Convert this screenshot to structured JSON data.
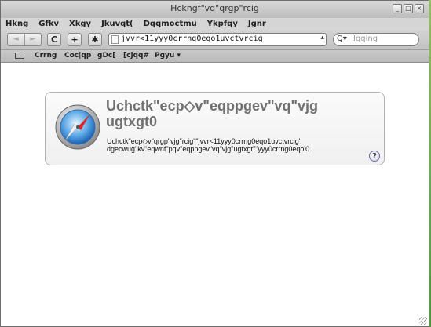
{
  "window": {
    "title": "Hckngf\"vq\"qrgp\"rcig"
  },
  "menubar": {
    "items": [
      "Hkng",
      "Gfkv",
      "Xkgy",
      "Jkuvqt(",
      "Dqqmoctmu",
      "Ykpfqy",
      "Jgnr"
    ]
  },
  "toolbar": {
    "back_label": "◄",
    "forward_label": "►",
    "reload_label": "C",
    "add_label": "+",
    "bug_label": "✱",
    "url": "jvvr<11yyy0crrng0eqo1uvctvrcig",
    "url_dropdown": "▴",
    "search_placeholder": "Iqqing",
    "search_icon": "Q▾"
  },
  "bookmarks": {
    "items": [
      "Crrng",
      "Coc|qp",
      "gDc[",
      "[cjqq#",
      "Pgyu ▾"
    ]
  },
  "error": {
    "title": "Uchctk\"ecp◇v\"eqppgev\"vq\"vjg ugtxgt0",
    "message": "Uchctk\"ecp◇v\"qrgp\"vjg\"rcig\"\"jvvr<11yyy0crrng0eqo1uvctvrcig' dgecwug\"kv\"eqwnf\"pqv\"eqppgev\"vq\"vjg\"ugtxgt\"\"yyy0crrng0eqo'0",
    "help_label": "?"
  },
  "colors": {
    "desktop": "#6fb34a",
    "title_text": "#707070",
    "chrome": "#c8c8c8"
  }
}
